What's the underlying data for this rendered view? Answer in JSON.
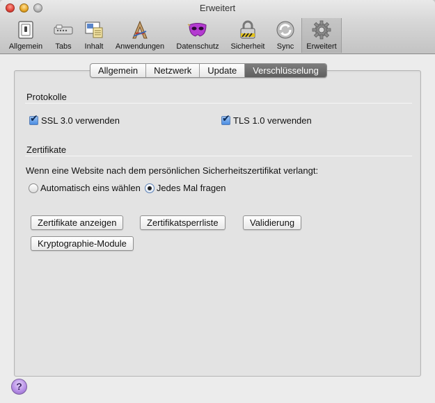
{
  "window": {
    "title": "Erweitert"
  },
  "toolbar": {
    "items": [
      {
        "label": "Allgemein",
        "icon": "switch-icon"
      },
      {
        "label": "Tabs",
        "icon": "tabs-icon"
      },
      {
        "label": "Inhalt",
        "icon": "content-icon"
      },
      {
        "label": "Anwendungen",
        "icon": "applications-icon"
      },
      {
        "label": "Datenschutz",
        "icon": "mask-icon"
      },
      {
        "label": "Sicherheit",
        "icon": "lock-icon"
      },
      {
        "label": "Sync",
        "icon": "sync-icon"
      },
      {
        "label": "Erweitert",
        "icon": "gear-icon",
        "selected": true
      }
    ]
  },
  "tabs": [
    {
      "label": "Allgemein"
    },
    {
      "label": "Netzwerk"
    },
    {
      "label": "Update"
    },
    {
      "label": "Verschlüsselung",
      "active": true
    }
  ],
  "protocols": {
    "title": "Protokolle",
    "ssl": {
      "label": "SSL 3.0 verwenden",
      "checked": true
    },
    "tls": {
      "label": "TLS 1.0 verwenden",
      "checked": true
    }
  },
  "certificates": {
    "title": "Zertifikate",
    "prompt": "Wenn eine Website nach dem persönlichen Sicherheitszertifikat verlangt:",
    "radio_auto": {
      "label": "Automatisch eins wählen",
      "selected": false
    },
    "radio_ask": {
      "label": "Jedes Mal fragen",
      "selected": true
    },
    "buttons": {
      "view": "Zertifikate anzeigen",
      "revocation": "Zertifikatsperrliste",
      "validation": "Validierung",
      "crypto": "Kryptographie-Module"
    }
  },
  "help": {
    "symbol": "?"
  },
  "colors": {
    "checkbox_accent": "#4a8ce2",
    "active_tab": "#6b6b6b",
    "help_button": "#b48be4"
  }
}
